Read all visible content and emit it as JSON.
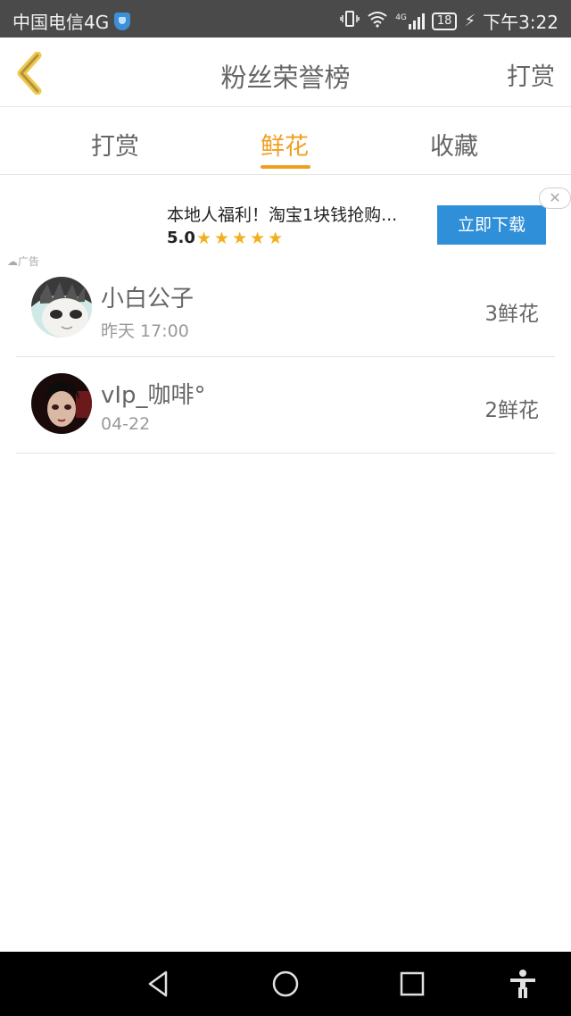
{
  "status_bar": {
    "carrier": "中国电信4G",
    "battery": "18",
    "time": "下午3:22",
    "network": "4G"
  },
  "header": {
    "title": "粉丝荣誉榜",
    "action_label": "打赏",
    "back_icon": "chevron-left-icon"
  },
  "tabs": [
    {
      "label": "打赏",
      "active": false
    },
    {
      "label": "鲜花",
      "active": true
    },
    {
      "label": "收藏",
      "active": false
    }
  ],
  "ad": {
    "title": "本地人福利！淘宝1块钱抢购...",
    "rating": "5.0",
    "stars": "★★★★★",
    "button_label": "立即下载",
    "close_label": "✕",
    "ad_label": "广告"
  },
  "fans": [
    {
      "name": "小白公子",
      "time": "昨天 17:00",
      "count": "3鲜花"
    },
    {
      "name": "vIp_咖啡°",
      "time": "04-22",
      "count": "2鲜花"
    }
  ],
  "colors": {
    "accent": "#f0a020",
    "ad_button": "#2f8fd8",
    "star": "#f2b01e"
  }
}
